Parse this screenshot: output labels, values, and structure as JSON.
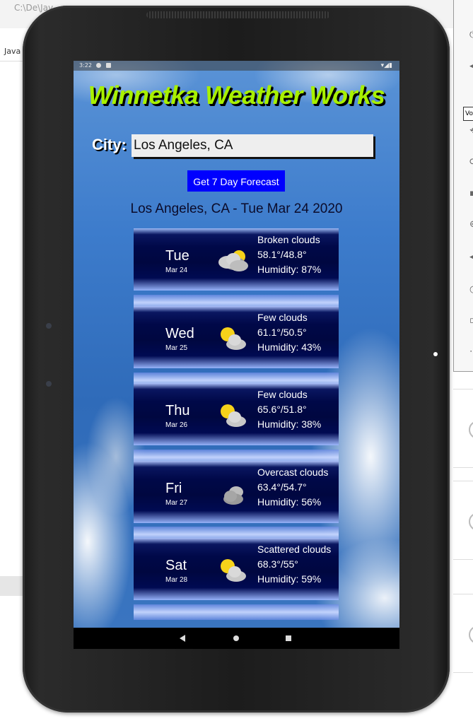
{
  "desktop": {
    "path_text": "C:\\De\\Jav",
    "java_label": "Java",
    "tooltip_text": "Vo"
  },
  "statusbar": {
    "time": "3:22",
    "right_icons": "▾◢▮"
  },
  "app": {
    "title": "Winnetka Weather Works",
    "city_label": "City:",
    "city_value": "Los Angeles, CA",
    "button_label": "Get 7 Day Forecast",
    "result_title": "Los Angeles, CA - Tue Mar 24 2020"
  },
  "forecast": [
    {
      "day": "Tue",
      "date": "Mar 24",
      "condition": "Broken clouds",
      "temps": "58.1°/48.8°",
      "humidity": "Humidity: 87%",
      "icon": "broken-clouds-icon"
    },
    {
      "day": "Wed",
      "date": "Mar 25",
      "condition": "Few clouds",
      "temps": "61.1°/50.5°",
      "humidity": "Humidity: 43%",
      "icon": "few-clouds-icon"
    },
    {
      "day": "Thu",
      "date": "Mar 26",
      "condition": "Few clouds",
      "temps": "65.6°/51.8°",
      "humidity": "Humidity: 38%",
      "icon": "few-clouds-icon"
    },
    {
      "day": "Fri",
      "date": "Mar 27",
      "condition": "Overcast clouds",
      "temps": "63.4°/54.7°",
      "humidity": "Humidity: 56%",
      "icon": "overcast-clouds-icon"
    },
    {
      "day": "Sat",
      "date": "Mar 28",
      "condition": "Scattered clouds",
      "temps": "68.3°/55°",
      "humidity": "Humidity: 59%",
      "icon": "scattered-clouds-icon"
    }
  ],
  "navbar": {
    "icons": [
      "back-icon",
      "home-icon",
      "recents-icon"
    ]
  },
  "colors": {
    "title": "#a8f000",
    "button": "#0000ff",
    "card": "#000848"
  }
}
